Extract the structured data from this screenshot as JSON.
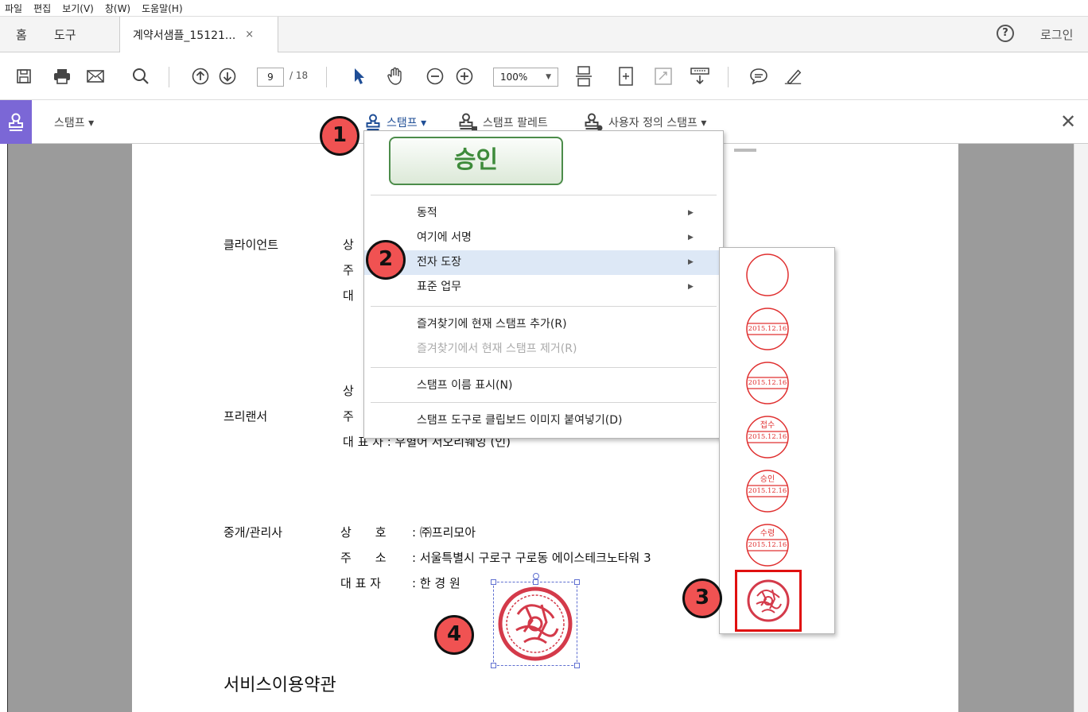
{
  "menubar": [
    "파일",
    "편집",
    "보기(V)",
    "창(W)",
    "도움말(H)"
  ],
  "tabs": {
    "home": "홈",
    "tools": "도구",
    "document": "계약서샘플_15121...",
    "close": "×"
  },
  "header": {
    "help": "?",
    "login": "로그인"
  },
  "toolbar": {
    "page_current": "9",
    "page_total": "/ 18",
    "zoom": "100%"
  },
  "stampbar": {
    "left_label": "스탬프 ▾",
    "stamp": "스탬프 ▾",
    "palette": "스탬프 팔레트",
    "custom": "사용자 정의 스탬프 ▾",
    "close": "✕"
  },
  "document": {
    "client": {
      "label": "클라이언트",
      "chars": [
        "상",
        "주",
        "대"
      ]
    },
    "freelancer": {
      "label": "프리랜서",
      "chars": [
        "상",
        "주"
      ],
      "rep_partial": "대 표 자 : 우혈어 서오리웨잉 (인)"
    },
    "agent": {
      "label": "중개/관리사",
      "row1_key": "상　　호",
      "row1_val": ": ㈜프리모아",
      "row2_key": "주　　소",
      "row2_val": ": 서울특별시 구로구 구로동 에이스테크노타워 3",
      "row3_key": "대 표 자",
      "row3_val": ": 한 경 원"
    },
    "section_title": "서비스이용약관"
  },
  "stamp_menu": {
    "preview": "승인",
    "items": [
      {
        "label": "동적",
        "submenu": true
      },
      {
        "label": "여기에 서명",
        "submenu": true
      },
      {
        "label": "전자 도장",
        "submenu": true
      },
      {
        "label": "표준 업무",
        "submenu": true
      },
      {
        "label": "즐겨찾기에 현재 스탬프 추가(R)"
      },
      {
        "label": "즐겨찾기에서 현재 스탬프 제거(R)",
        "disabled": true
      },
      {
        "label": "스탬프 이름 표시(N)"
      },
      {
        "label": "스탬프 도구로 클립보드 이미지 붙여넣기(D)"
      }
    ]
  },
  "seals": {
    "date": "2015.12.16",
    "labels": [
      "접수",
      "승인",
      "수령"
    ]
  },
  "callouts": [
    "1",
    "2",
    "3",
    "4"
  ],
  "colors": {
    "stamp_red": "#e03030",
    "accent": "#1f4e96",
    "highlight": "#dde8f6",
    "callout": "#f05252"
  }
}
